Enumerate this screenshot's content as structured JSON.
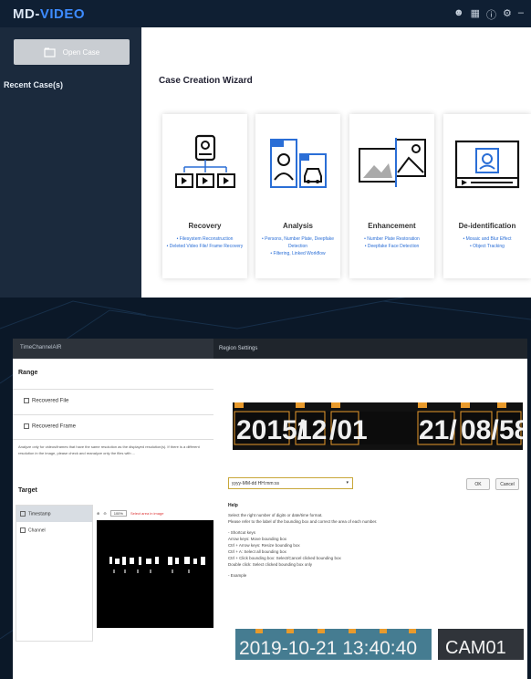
{
  "brand": {
    "part1": "MD-",
    "part2": "VIDEO"
  },
  "top_icons": [
    "user-icon",
    "trash-icon",
    "help-icon",
    "gear-icon",
    "minimize-icon"
  ],
  "sidebar": {
    "open_case": "Open Case",
    "recent": "Recent Case(s)"
  },
  "wizard": {
    "title": "Case Creation Wizard",
    "cards": [
      {
        "title": "Recovery",
        "items": [
          "• Filesystem Reconstruction",
          "• Deleted Video File/ Frame Recovery"
        ]
      },
      {
        "title": "Analysis",
        "items": [
          "• Persons, Number Plate, Deepfake Detection",
          "• Filtering, Linked Workflow"
        ]
      },
      {
        "title": "Enhancement",
        "items": [
          "• Number Plate Restoration",
          "• Deepfake Face Detection"
        ]
      },
      {
        "title": "De-identification",
        "items": [
          "• Mosaic and Blur Effect",
          "• Object Tracking"
        ]
      }
    ]
  },
  "range_window": {
    "title": "TimeChannelAIR",
    "range_header": "Range",
    "rows": [
      "Recovered File",
      "Recovered Frame"
    ],
    "note": "Analyze only for videos/frames that have the same resolution as the displayed resolution(s). If there is a different resolution in the image, please check and reanalyze only the files with ...",
    "target_header": "Target",
    "targets": [
      "Timestamp",
      "Channel"
    ],
    "zoom": "100%",
    "hint": "Select area in image"
  },
  "region_dialog": {
    "title": "Region Settings",
    "strip_chars": [
      "2015/",
      "12",
      "/01",
      "21/",
      "08/",
      "58"
    ],
    "format_value": "yyyy-MM-dd HH:mm:ss",
    "ok": "OK",
    "cancel": "Cancel",
    "help_title": "Help",
    "help_lines": [
      "Select the right number of digits or date/time format.",
      "Please refer to the label of the bounding box and correct the area of each number.",
      "",
      "- Shortcut keys",
      "  Arrow keys: Move bounding box",
      "  Ctrl + Arrow keys: Resize bounding box",
      "  Ctrl + A: Select all bounding box",
      "  Ctrl + Click bounding box: Select/Cancel clicked bounding box",
      "  Double click: Select clicked bounding box only",
      "",
      "- Example"
    ],
    "example_text": "2019-10-21 13:40:40",
    "example_cam": "CAM01"
  }
}
